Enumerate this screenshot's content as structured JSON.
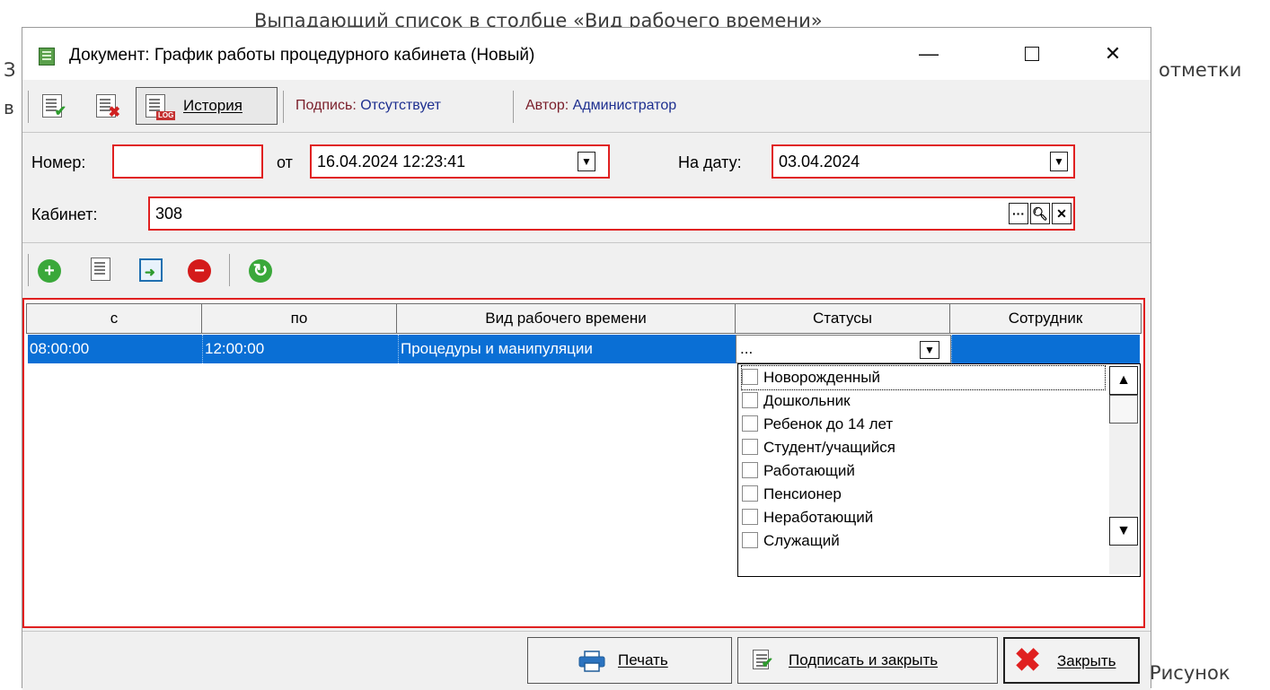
{
  "background": {
    "caption": "Выпадающий список в столбце «Вид рабочего времени»",
    "left_line1": "З",
    "left_line2": "в",
    "right_line1": "отметки",
    "right_line2": "Рисунок"
  },
  "window": {
    "title": "Документ: График работы процедурного кабинета (Новый)",
    "controls": {
      "minimize": "—",
      "close": "✕"
    }
  },
  "toolbar": {
    "history_label": "История",
    "log_tag": "LOG",
    "signature_label": "Подпись:",
    "signature_value": "Отсутствует",
    "author_label": "Автор:",
    "author_value": "Администратор"
  },
  "form": {
    "number_label": "Номер:",
    "number_value": "",
    "from_label": "от",
    "from_value": "16.04.2024 12:23:41",
    "date_label": "На дату:",
    "date_value": "03.04.2024",
    "cabinet_label": "Кабинет:",
    "cabinet_value": "308",
    "dropdown_glyph": "▼",
    "ellipsis_glyph": "···",
    "search_glyph": "🔍︎",
    "clear_glyph": "✕"
  },
  "grid": {
    "columns": [
      "с",
      "по",
      "Вид рабочего времени",
      "Статусы",
      "Сотрудник"
    ],
    "rows": [
      {
        "from": "08:00:00",
        "to": "12:00:00",
        "work_type": "Процедуры и манипуляции",
        "statuses": "...",
        "employee": ""
      }
    ]
  },
  "status_dropdown": {
    "options": [
      "Новорожденный",
      "Дошкольник",
      "Ребенок до 14 лет",
      "Студент/учащийся",
      "Работающий",
      "Пенсионер",
      "Неработающий",
      "Служащий"
    ],
    "scroll_up": "▲",
    "scroll_down": "▼"
  },
  "footer": {
    "print_label": "Печать",
    "sign_close_label": "Подписать и закрыть",
    "close_label": "Закрыть"
  },
  "colors": {
    "selection": "#0a6fd5",
    "required_border": "#e02020",
    "label_dark_red": "#7a1e2a",
    "value_blue": "#1d2f8f"
  }
}
